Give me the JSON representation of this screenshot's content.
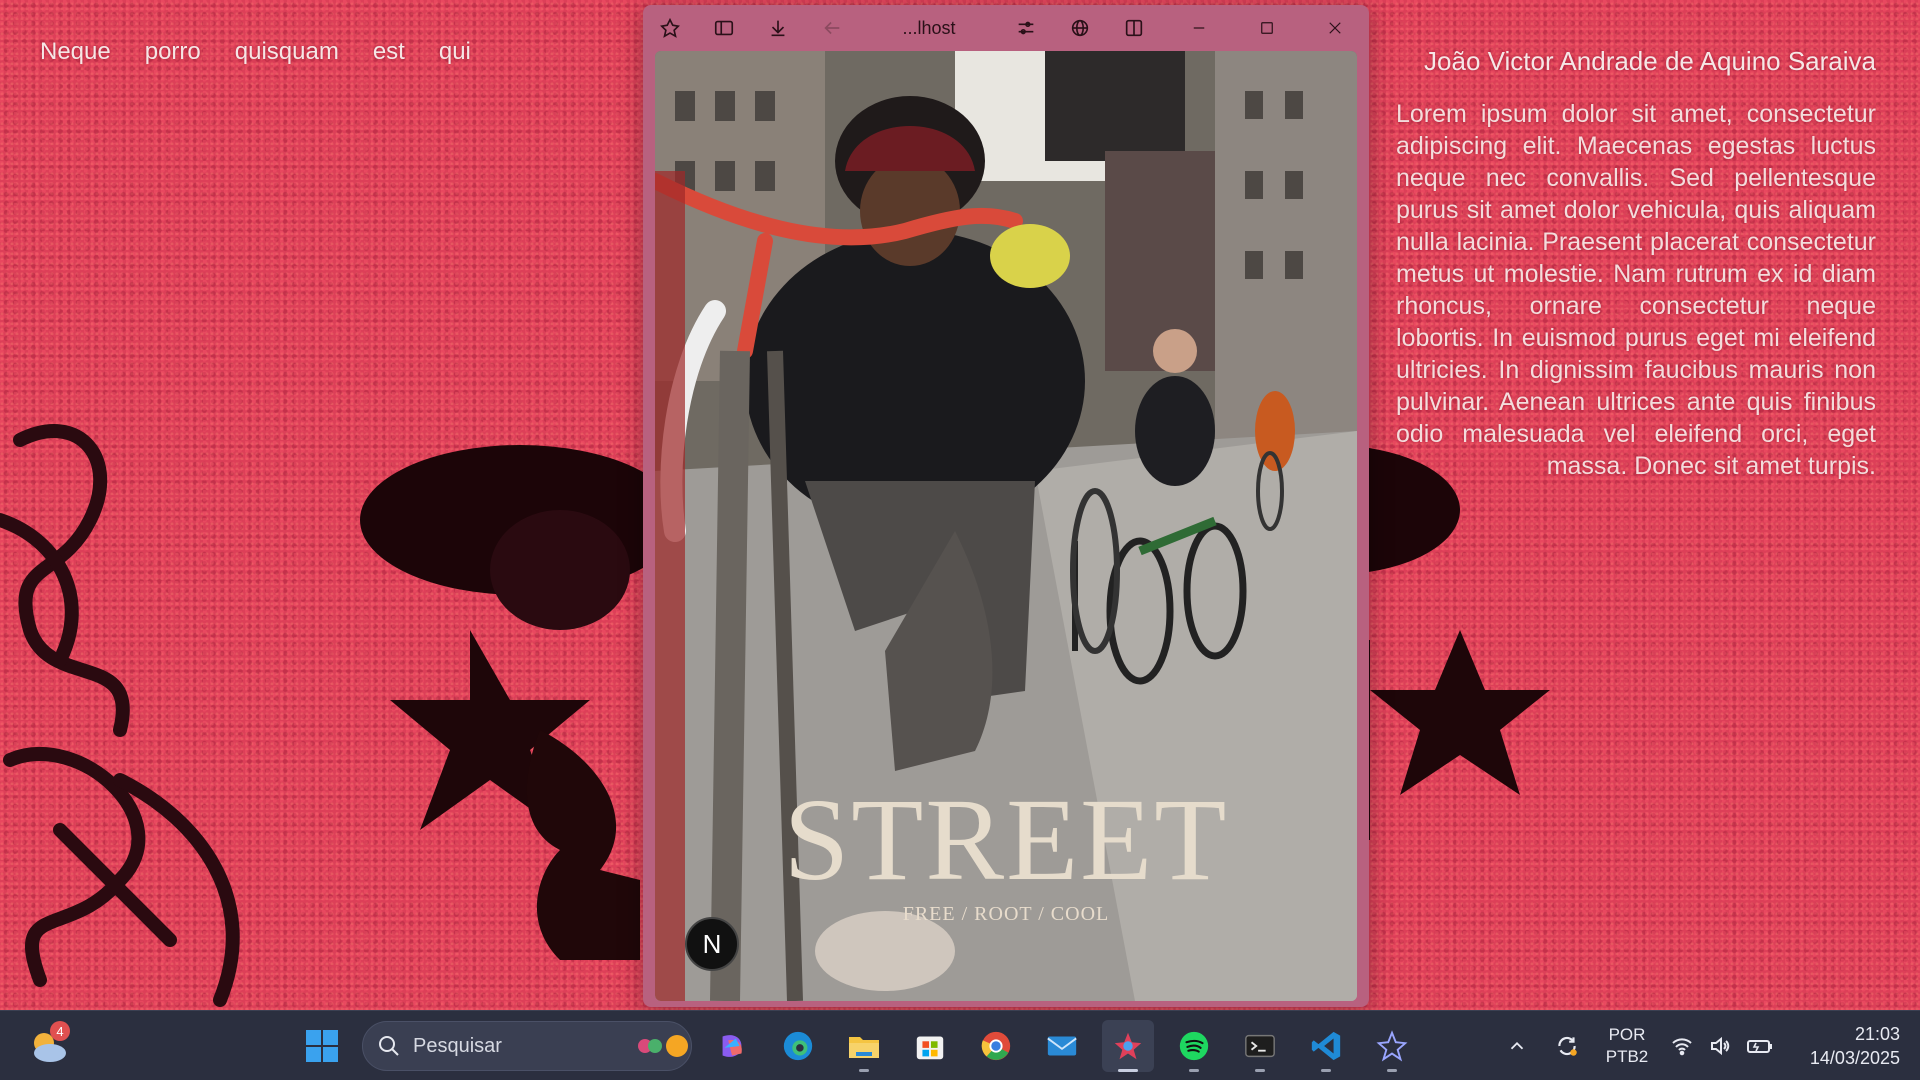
{
  "page": {
    "nav_links": [
      "Neque",
      "porro",
      "quisquam",
      "est",
      "qui"
    ],
    "author": "João Victor Andrade de Aquino Saraiva",
    "lorem": "Lorem ipsum dolor sit amet, consectetur adipiscing elit. Maecenas egestas luctus neque nec convallis. Sed pellentesque purus sit amet dolor vehicula, quis aliquam nulla lacinia. Praesent placerat consectetur metus ut molestie. Nam rutrum ex id diam rhoncus, ornare consectetur neque lobortis. In euismod purus eget mi eleifend ultricies. In dignissim faucibus mauris non pulvinar. Aenean ultrices ante quis finibus odio malesuada vel eleifend orci, eget massa. Donec sit amet turpis."
  },
  "browser": {
    "url": "...lhost",
    "poster_title": "STREET",
    "poster_subtitle": "FREE / ROOT / COOL",
    "badge_letter": "N"
  },
  "taskbar": {
    "weather_badge": "4",
    "search_placeholder": "Pesquisar",
    "language_top": "POR",
    "language_bottom": "PTB2",
    "time": "21:03",
    "date": "14/03/2025",
    "apps": [
      "copilot-icon",
      "edge-icon",
      "file-explorer-icon",
      "store-icon",
      "chrome-icon",
      "mail-icon",
      "browser-app-icon",
      "spotify-icon",
      "terminal-icon",
      "vscode-icon",
      "misc-app-icon"
    ]
  },
  "colors": {
    "background_red": "#dd3f58",
    "window_frame": "#b8617f",
    "taskbar": "#2b2f3f"
  }
}
